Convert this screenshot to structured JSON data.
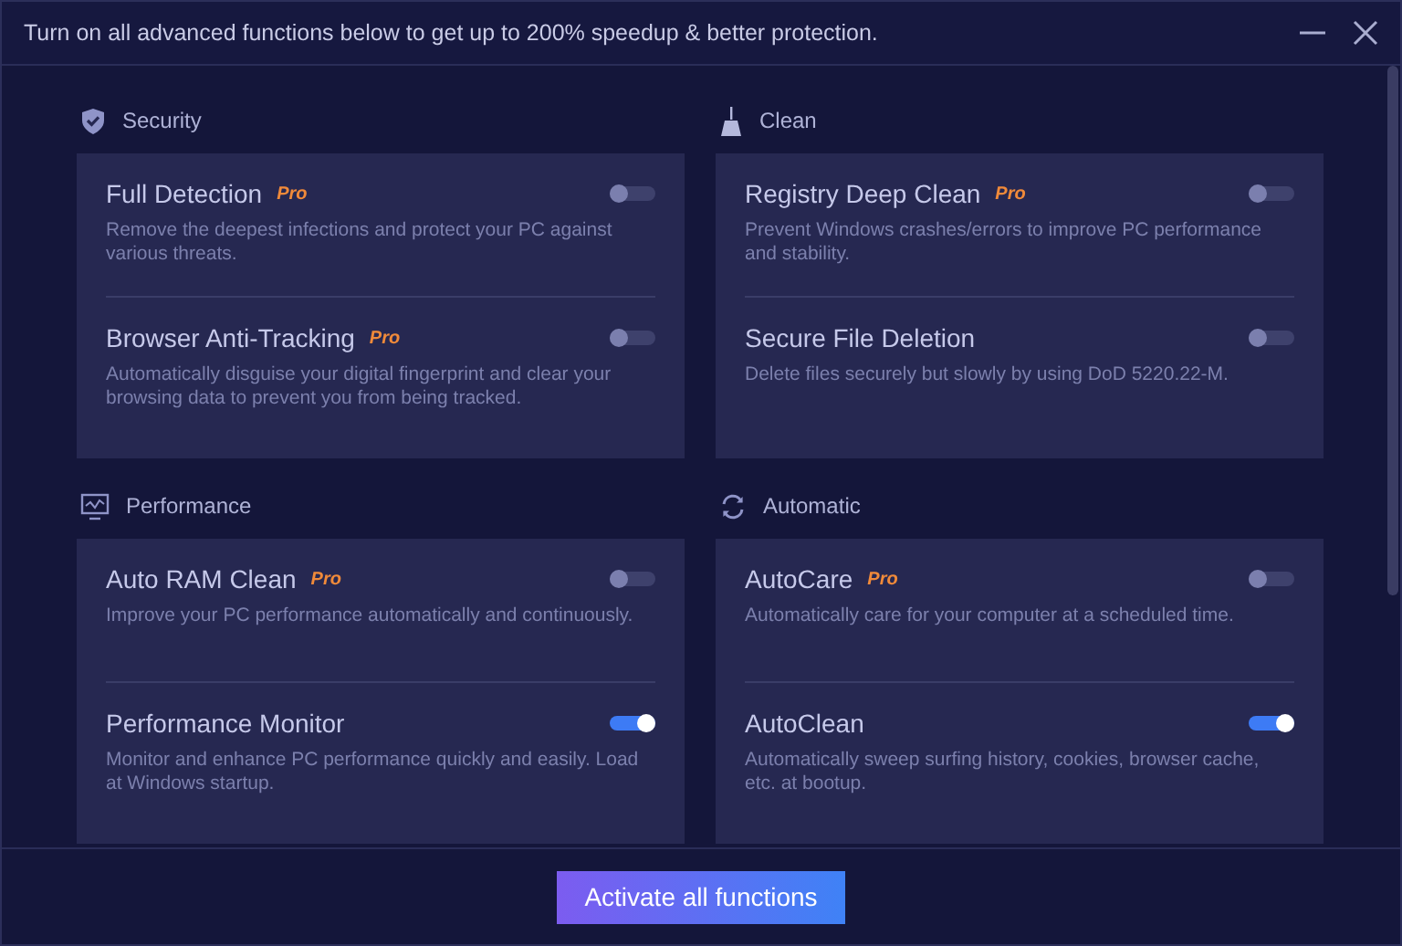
{
  "window": {
    "title": "Turn on all advanced functions below to get up to 200% speedup & better protection."
  },
  "sections": [
    {
      "title": "Security",
      "items": [
        {
          "title": "Full Detection",
          "badge": "Pro",
          "description": "Remove the deepest infections and protect your PC against various threats.",
          "on": false
        },
        {
          "title": "Browser Anti-Tracking",
          "badge": "Pro",
          "description": "Automatically disguise your digital fingerprint and clear your browsing data to prevent you from being tracked.",
          "on": false
        }
      ]
    },
    {
      "title": "Clean",
      "items": [
        {
          "title": "Registry Deep Clean",
          "badge": "Pro",
          "description": "Prevent Windows crashes/errors to improve PC performance and stability.",
          "on": false
        },
        {
          "title": "Secure File Deletion",
          "description": "Delete files securely but slowly by using DoD 5220.22-M.",
          "on": false
        }
      ]
    },
    {
      "title": "Performance",
      "items": [
        {
          "title": "Auto RAM Clean",
          "badge": "Pro",
          "description": "Improve your PC performance automatically and continuously.",
          "on": false
        },
        {
          "title": "Performance Monitor",
          "description": "Monitor and enhance PC performance quickly and easily. Load at Windows startup.",
          "on": true
        }
      ]
    },
    {
      "title": "Automatic",
      "items": [
        {
          "title": "AutoCare",
          "badge": "Pro",
          "description": "Automatically care for your computer at a scheduled time.",
          "on": false
        },
        {
          "title": "AutoClean",
          "description": "Automatically sweep surfing history, cookies, browser cache, etc. at bootup.",
          "on": true
        }
      ]
    }
  ],
  "footer": {
    "button": "Activate all functions"
  }
}
